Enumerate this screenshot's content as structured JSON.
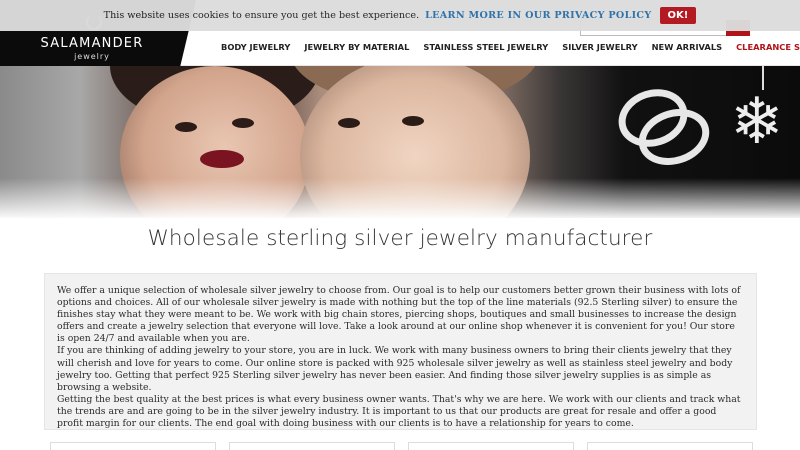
{
  "cookie_bar": {
    "message": "This website uses cookies to ensure you get the best experience.",
    "link_label": "LEARN MORE IN OUR PRIVACY POLICY",
    "ok_label": "OK!"
  },
  "brand": {
    "name": "SALAMANDER",
    "subtitle": "jewelry"
  },
  "nav": {
    "items": [
      {
        "label": "BODY JEWELRY"
      },
      {
        "label": "JEWELRY BY MATERIAL"
      },
      {
        "label": "STAINLESS STEEL JEWELRY"
      },
      {
        "label": "SILVER JEWELRY"
      },
      {
        "label": "NEW ARRIVALS"
      },
      {
        "label": "CLEARANCE SALE"
      }
    ]
  },
  "colors": {
    "accent": "#b1131b",
    "link": "#2a6fa8"
  },
  "main": {
    "title": "Wholesale sterling silver jewelry manufacturer",
    "paragraphs": [
      "We offer a unique selection of wholesale silver jewelry to choose from. Our goal is to help our customers better grown their business with lots of options and choices. All of our wholesale silver jewelry is made with nothing but the top of the line materials (92.5 Sterling silver) to ensure the finishes stay what they were meant to be. We work with big chain stores, piercing shops, boutiques and small businesses to increase the design offers and create a jewelry selection that everyone will love. Take a look around at our online shop whenever it is convenient for you! Our store is open 24/7 and available when you are.",
      "If you are thinking of adding jewelry to your store, you are in luck. We work with many business owners to bring their clients jewelry that they will cherish and love for years to come. Our online store is packed with 925 wholesale silver jewelry as well as stainless steel jewelry and body jewelry too. Getting that perfect 925 Sterling silver jewelry has never been easier. And finding those silver jewelry supplies is as simple as browsing a website.",
      "Getting the best quality at the best prices is what every business owner wants. That's why we are here. We work with our clients and track what the trends are and are going to be in the silver jewelry industry. It is important to us that our products are great for resale and offer a good profit margin for our clients. The end goal with doing business with our clients is to have a relationship for years to come."
    ]
  }
}
